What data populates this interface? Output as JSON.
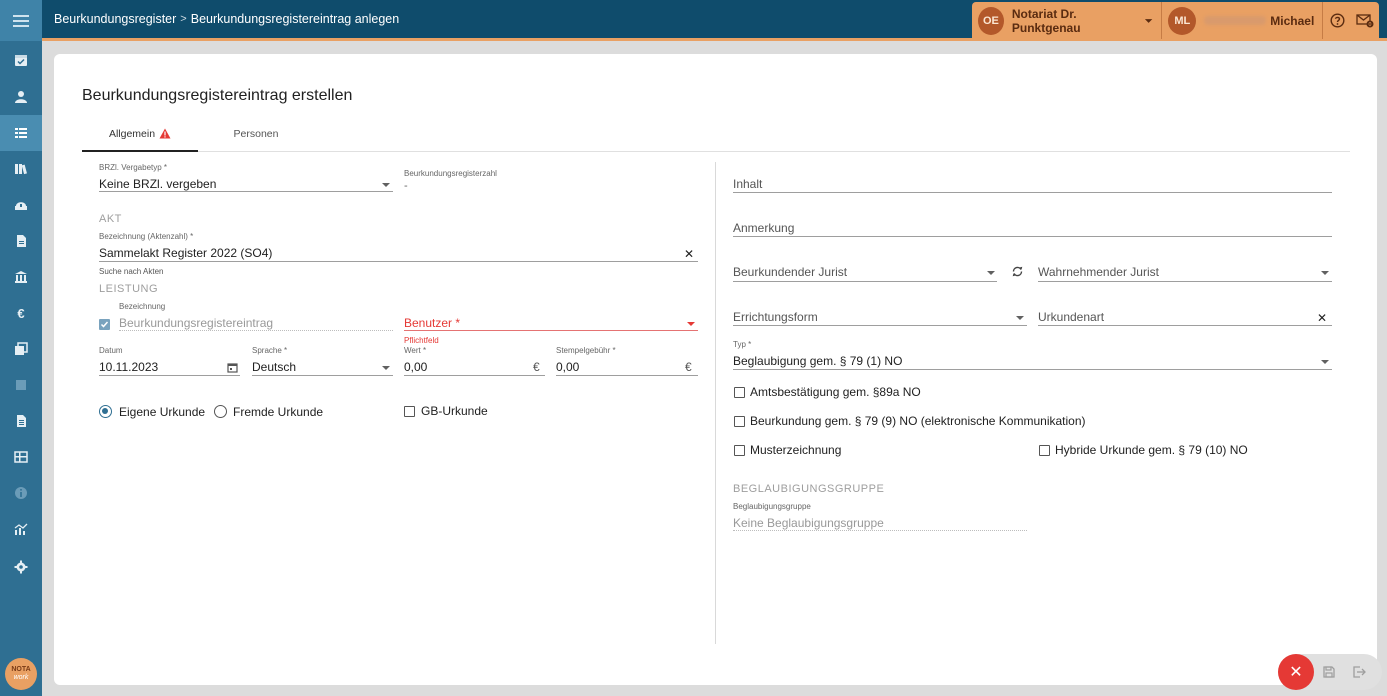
{
  "breadcrumb": {
    "root": "Beurkundungsregister",
    "separator": ">",
    "current": "Beurkundungsregistereintrag anlegen"
  },
  "header": {
    "org_initials": "OE",
    "org_name": "Notariat Dr. Punktgenau",
    "user_initials": "ML",
    "user_name": "Michael"
  },
  "sidebar": {
    "logo_line1": "NOTA",
    "logo_line2": "work",
    "items": [
      "calendar-check-icon",
      "person-icon",
      "list-icon",
      "books-icon",
      "bank-lock-icon",
      "document-icon",
      "bank-icon",
      "euro-icon",
      "copy-icon",
      "square-icon",
      "file-icon",
      "register-icon",
      "info-icon",
      "chart-icon",
      "gear-icon"
    ]
  },
  "page": {
    "title": "Beurkundungsregistereintrag erstellen",
    "tabs": [
      {
        "label": "Allgemein",
        "warning": true
      },
      {
        "label": "Personen"
      }
    ]
  },
  "left": {
    "vergabetyp": {
      "label": "BRZl. Vergabetyp *",
      "value": "Keine BRZl. vergeben"
    },
    "registerzahl": {
      "label": "Beurkundungsregisterzahl",
      "value": "-"
    },
    "akt_section": "AKT",
    "bezeichnung_akt": {
      "label": "Bezeichnung (Aktenzahl) *",
      "value": "Sammelakt Register 2022 (SO4)",
      "hint": "Suche nach Akten"
    },
    "leistung_section": "LEISTUNG",
    "bezeichnung": {
      "label": "Bezeichnung",
      "value": "Beurkundungsregistereintrag",
      "checked": true
    },
    "benutzer": {
      "placeholder": "Benutzer *",
      "error": "Pflichtfeld"
    },
    "datum": {
      "label": "Datum",
      "value": "10.11.2023"
    },
    "sprache": {
      "label": "Sprache *",
      "value": "Deutsch"
    },
    "wert": {
      "label": "Wert *",
      "value": "0,00",
      "currency": "€"
    },
    "stempel": {
      "label": "Stempelgebühr *",
      "value": "0,00",
      "currency": "€"
    },
    "radio_eigene": "Eigene Urkunde",
    "radio_fremde": "Fremde Urkunde",
    "gb_urkunde": "GB-Urkunde"
  },
  "right": {
    "inhalt": "Inhalt",
    "anmerkung": "Anmerkung",
    "beurkundender": "Beurkundender Jurist",
    "wahrnehmender": "Wahrnehmender Jurist",
    "errichtungsform": "Errichtungsform",
    "urkundenart": "Urkundenart",
    "typ": {
      "label": "Typ *",
      "value": "Beglaubigung gem. § 79 (1) NO"
    },
    "chk_amts": "Amtsbestätigung gem. §89a NO",
    "chk_beurk": "Beurkundung gem. § 79 (9) NO (elektronische Kommunikation)",
    "chk_muster": "Musterzeichnung",
    "chk_hybrid": "Hybride Urkunde gem. § 79 (10) NO",
    "beglaubigung_section": "BEGLAUBIGUNGSGRUPPE",
    "beglaubigungsgruppe": {
      "label": "Beglaubigungsgruppe",
      "value": "Keine Beglaubigungsgruppe"
    }
  },
  "colors": {
    "accent": "#e9a063",
    "topbar": "#0f4c6c",
    "sidebar": "#2f6f92",
    "error": "#e53935"
  }
}
